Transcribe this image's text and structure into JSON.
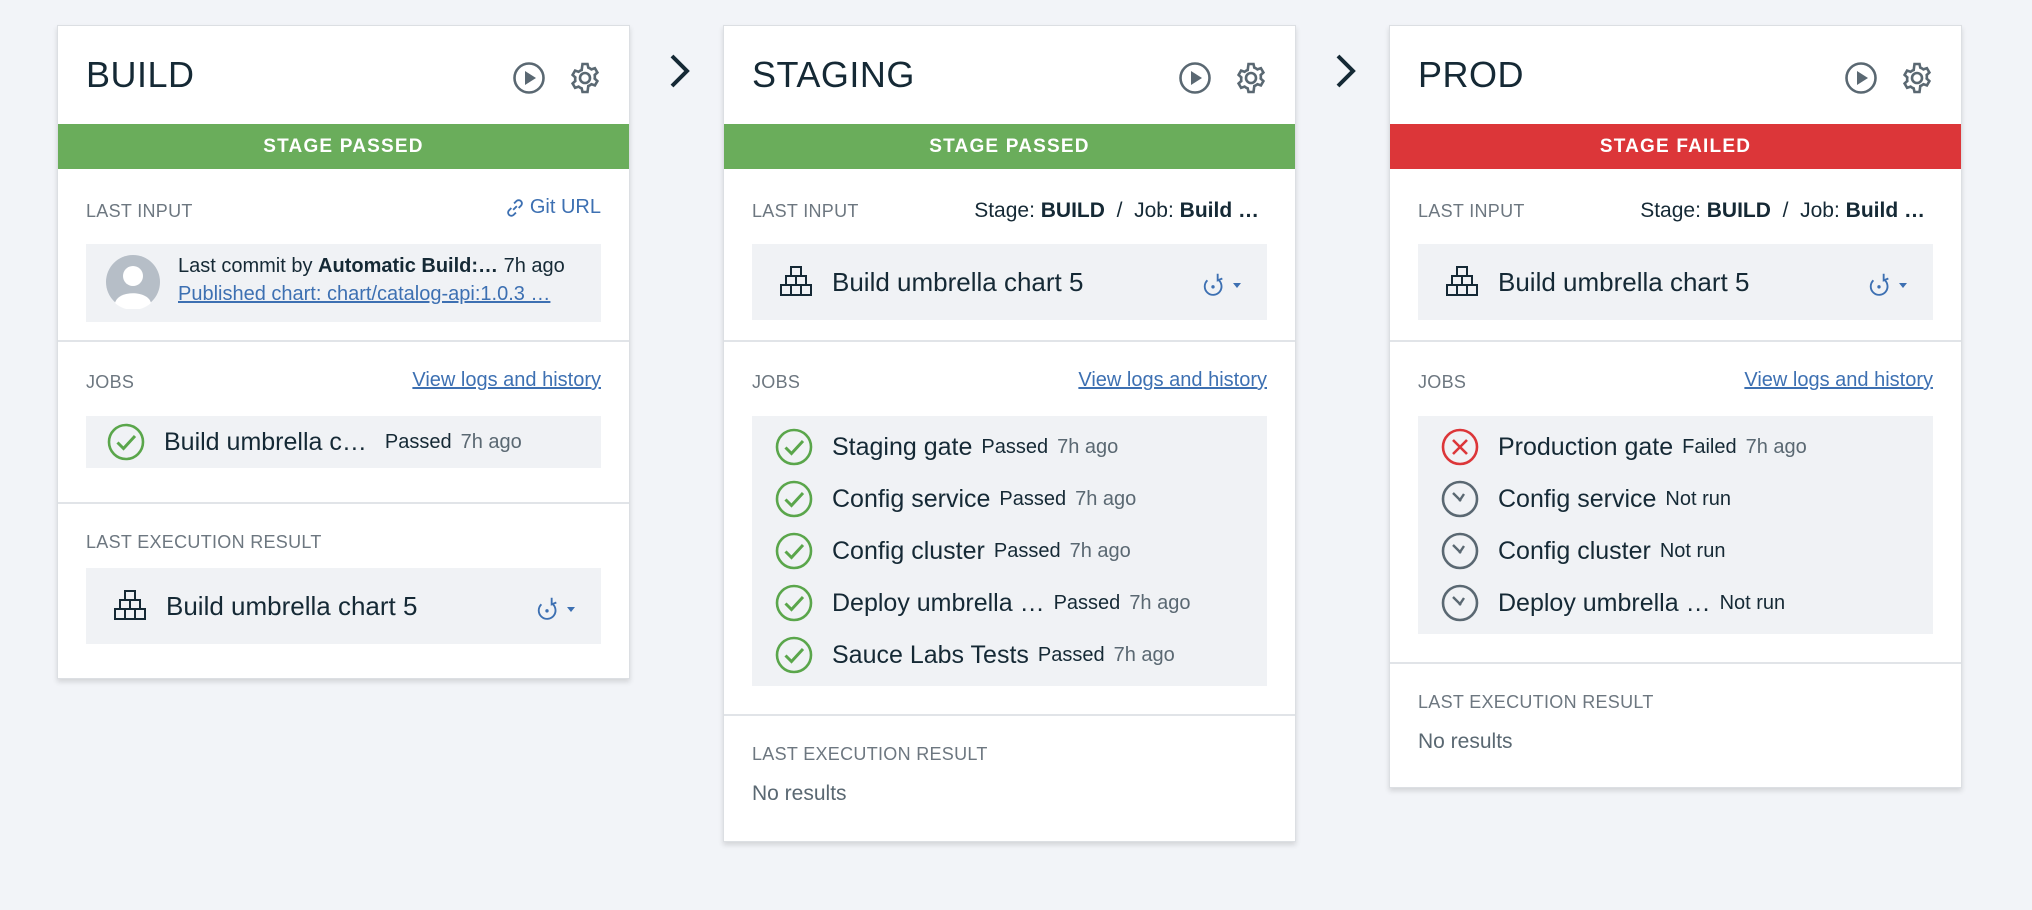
{
  "colors": {
    "passed": "#6aad5b",
    "failed": "#dc3639",
    "link": "#3d70b2"
  },
  "stages": [
    {
      "title": "BUILD",
      "status": "STAGE PASSED",
      "last_input_label": "LAST INPUT",
      "git_url_label": "Git URL",
      "commit_prefix": "Last commit by",
      "commit_author": "Automatic Build:…",
      "commit_time": "7h ago",
      "commit_message": "Published chart: chart/catalog-api:1.0.3 …",
      "jobs_label": "JOBS",
      "view_logs": "View logs and history",
      "jobs": [
        {
          "name": "Build umbrella c…",
          "status": "Passed",
          "time": "7h ago",
          "icon": "check-circle-icon"
        }
      ],
      "last_exec_label": "LAST EXECUTION RESULT",
      "last_exec_name": "Build umbrella chart 5"
    },
    {
      "title": "STAGING",
      "status": "STAGE PASSED",
      "last_input_label": "LAST INPUT",
      "input_stage_prefix": "Stage:",
      "input_stage": "BUILD",
      "input_sep": "/",
      "input_job_prefix": "Job:",
      "input_job": "Build …",
      "input_build": "Build umbrella chart 5",
      "jobs_label": "JOBS",
      "view_logs": "View logs and history",
      "jobs": [
        {
          "name": "Staging gate",
          "status": "Passed",
          "time": "7h ago",
          "icon": "check-circle-icon"
        },
        {
          "name": "Config service",
          "status": "Passed",
          "time": "7h ago",
          "icon": "check-circle-icon"
        },
        {
          "name": "Config cluster",
          "status": "Passed",
          "time": "7h ago",
          "icon": "check-circle-icon"
        },
        {
          "name": "Deploy umbrella …",
          "status": "Passed",
          "time": "7h ago",
          "icon": "check-circle-icon"
        },
        {
          "name": "Sauce Labs Tests",
          "status": "Passed",
          "time": "7h ago",
          "icon": "check-circle-icon"
        }
      ],
      "last_exec_label": "LAST EXECUTION RESULT",
      "no_results": "No results"
    },
    {
      "title": "PROD",
      "status": "STAGE FAILED",
      "last_input_label": "LAST INPUT",
      "input_stage_prefix": "Stage:",
      "input_stage": "BUILD",
      "input_sep": "/",
      "input_job_prefix": "Job:",
      "input_job": "Build …",
      "input_build": "Build umbrella chart 5",
      "jobs_label": "JOBS",
      "view_logs": "View logs and history",
      "jobs": [
        {
          "name": "Production gate",
          "status": "Failed",
          "time": "7h ago",
          "icon": "x-circle-icon"
        },
        {
          "name": "Config service",
          "status": "Not run",
          "time": "",
          "icon": "clock-icon"
        },
        {
          "name": "Config cluster",
          "status": "Not run",
          "time": "",
          "icon": "clock-icon"
        },
        {
          "name": "Deploy umbrella …",
          "status": "Not run",
          "time": "",
          "icon": "clock-icon"
        }
      ],
      "last_exec_label": "LAST EXECUTION RESULT",
      "no_results": "No results"
    }
  ]
}
